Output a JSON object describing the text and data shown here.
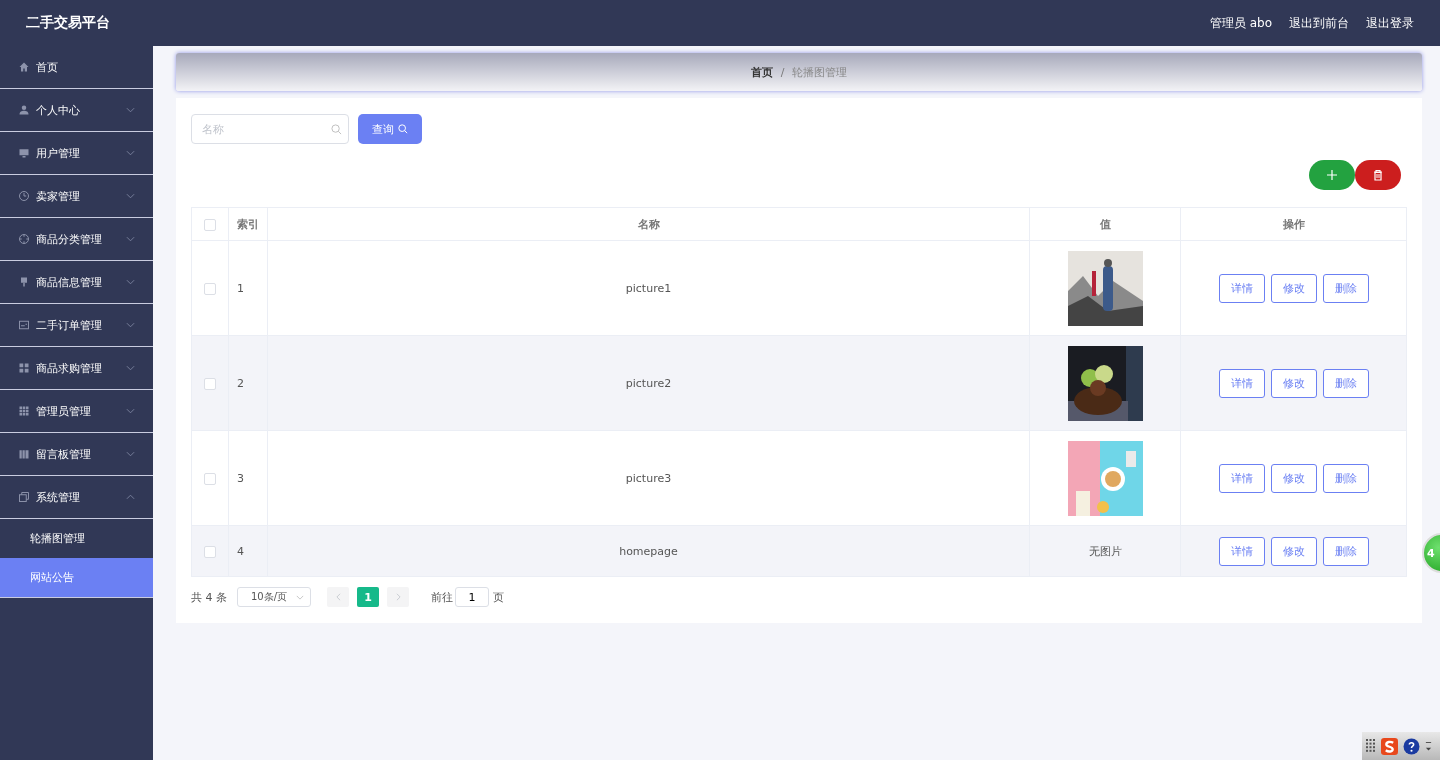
{
  "header": {
    "title": "二手交易平台",
    "user": "管理员 abo",
    "links": [
      "退出到前台",
      "退出登录"
    ]
  },
  "sidebar": {
    "items": [
      {
        "label": "首页"
      },
      {
        "label": "个人中心",
        "expanded": false
      },
      {
        "label": "用户管理",
        "expanded": false
      },
      {
        "label": "卖家管理",
        "expanded": false
      },
      {
        "label": "商品分类管理",
        "expanded": false
      },
      {
        "label": "商品信息管理",
        "expanded": false
      },
      {
        "label": "二手订单管理",
        "expanded": false
      },
      {
        "label": "商品求购管理",
        "expanded": false
      },
      {
        "label": "管理员管理",
        "expanded": false
      },
      {
        "label": "留言板管理",
        "expanded": false
      },
      {
        "label": "系统管理",
        "expanded": true,
        "children": [
          {
            "label": "轮播图管理",
            "selected": false
          },
          {
            "label": "网站公告",
            "selected": true
          }
        ]
      }
    ]
  },
  "breadcrumb": {
    "items": [
      "首页",
      "轮播图管理"
    ],
    "separator": "/"
  },
  "search": {
    "placeholder": "名称",
    "button": "查询"
  },
  "table": {
    "select_all_checked": false,
    "columns": [
      "索引",
      "名称",
      "值",
      "操作"
    ],
    "rows": [
      {
        "checked": false,
        "index": "1",
        "name": "picture1",
        "value": {
          "kind": "picture"
        },
        "actions": [
          "详情",
          "修改",
          "删除"
        ]
      },
      {
        "checked": false,
        "index": "2",
        "name": "picture2",
        "value": {
          "kind": "picture"
        },
        "actions": [
          "详情",
          "修改",
          "删除"
        ]
      },
      {
        "checked": false,
        "index": "3",
        "name": "picture3",
        "value": {
          "kind": "picture"
        },
        "actions": [
          "详情",
          "修改",
          "删除"
        ]
      },
      {
        "checked": false,
        "index": "4",
        "name": "homepage",
        "value": {
          "kind": "text",
          "text": "无图片"
        },
        "actions": [
          "详情",
          "修改",
          "删除"
        ]
      }
    ]
  },
  "pagination": {
    "total": "共 4 条",
    "page_size": "10条/页",
    "pages": [
      {
        "label": "1",
        "selected": true
      }
    ],
    "goto_label": "前往",
    "goto_value": "1",
    "goto_suffix": "页"
  },
  "floating_badge": "4"
}
